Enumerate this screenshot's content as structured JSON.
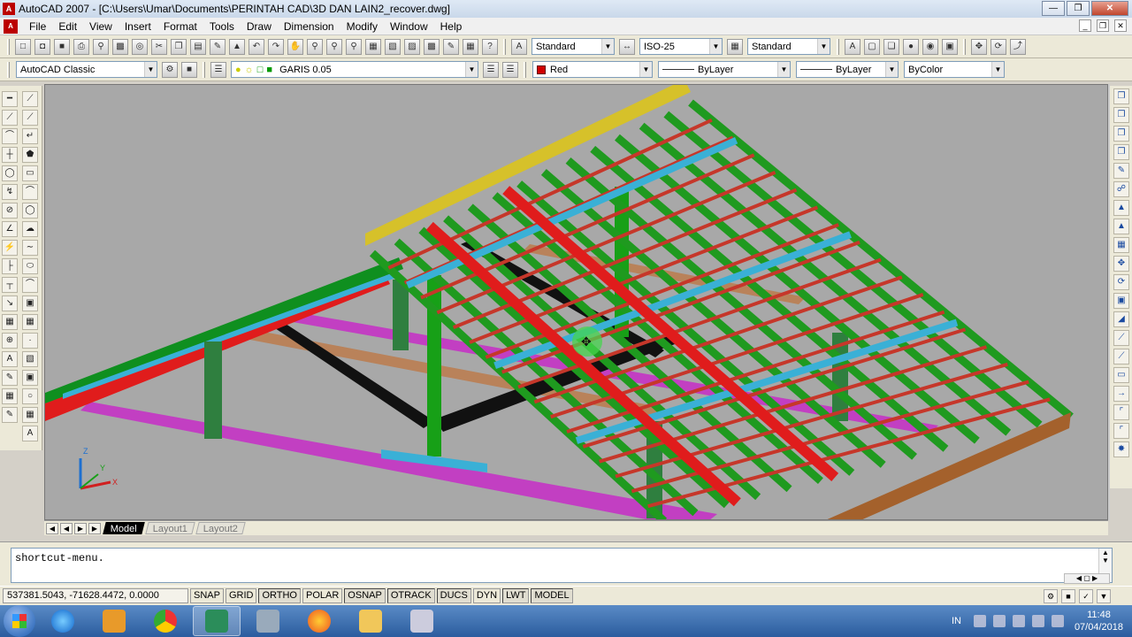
{
  "window": {
    "title": "AutoCAD 2007 - [C:\\Users\\Umar\\Documents\\PERINTAH CAD\\3D DAN LAIN2_recover.dwg]",
    "app_icon": "autocad-icon"
  },
  "menu": [
    "File",
    "Edit",
    "View",
    "Insert",
    "Format",
    "Tools",
    "Draw",
    "Dimension",
    "Modify",
    "Window",
    "Help"
  ],
  "styles": {
    "text_style": "Standard",
    "dim_style": "ISO-25",
    "table_style": "Standard"
  },
  "workspace": "AutoCAD Classic",
  "layer": {
    "current": "GARIS 0.05"
  },
  "properties": {
    "color": "Red",
    "color_hex": "#d00000",
    "linetype": "ByLayer",
    "lineweight": "ByLayer",
    "plotstyle": "ByColor"
  },
  "tabs": [
    "Model",
    "Layout1",
    "Layout2"
  ],
  "command_line": {
    "text": "shortcut-menu."
  },
  "status": {
    "coordinates": "537381.5043, -71628.4472, 0.0000",
    "toggles": [
      {
        "label": "SNAP",
        "on": false
      },
      {
        "label": "GRID",
        "on": false
      },
      {
        "label": "ORTHO",
        "on": true
      },
      {
        "label": "POLAR",
        "on": false
      },
      {
        "label": "OSNAP",
        "on": true
      },
      {
        "label": "OTRACK",
        "on": true
      },
      {
        "label": "DUCS",
        "on": true
      },
      {
        "label": "DYN",
        "on": false
      },
      {
        "label": "LWT",
        "on": true
      },
      {
        "label": "MODEL",
        "on": true
      }
    ]
  },
  "ucs": {
    "z": "Z",
    "y": "Y",
    "x": "X"
  },
  "taskbar": {
    "language": "IN",
    "time": "11:48",
    "date": "07/04/2018"
  }
}
